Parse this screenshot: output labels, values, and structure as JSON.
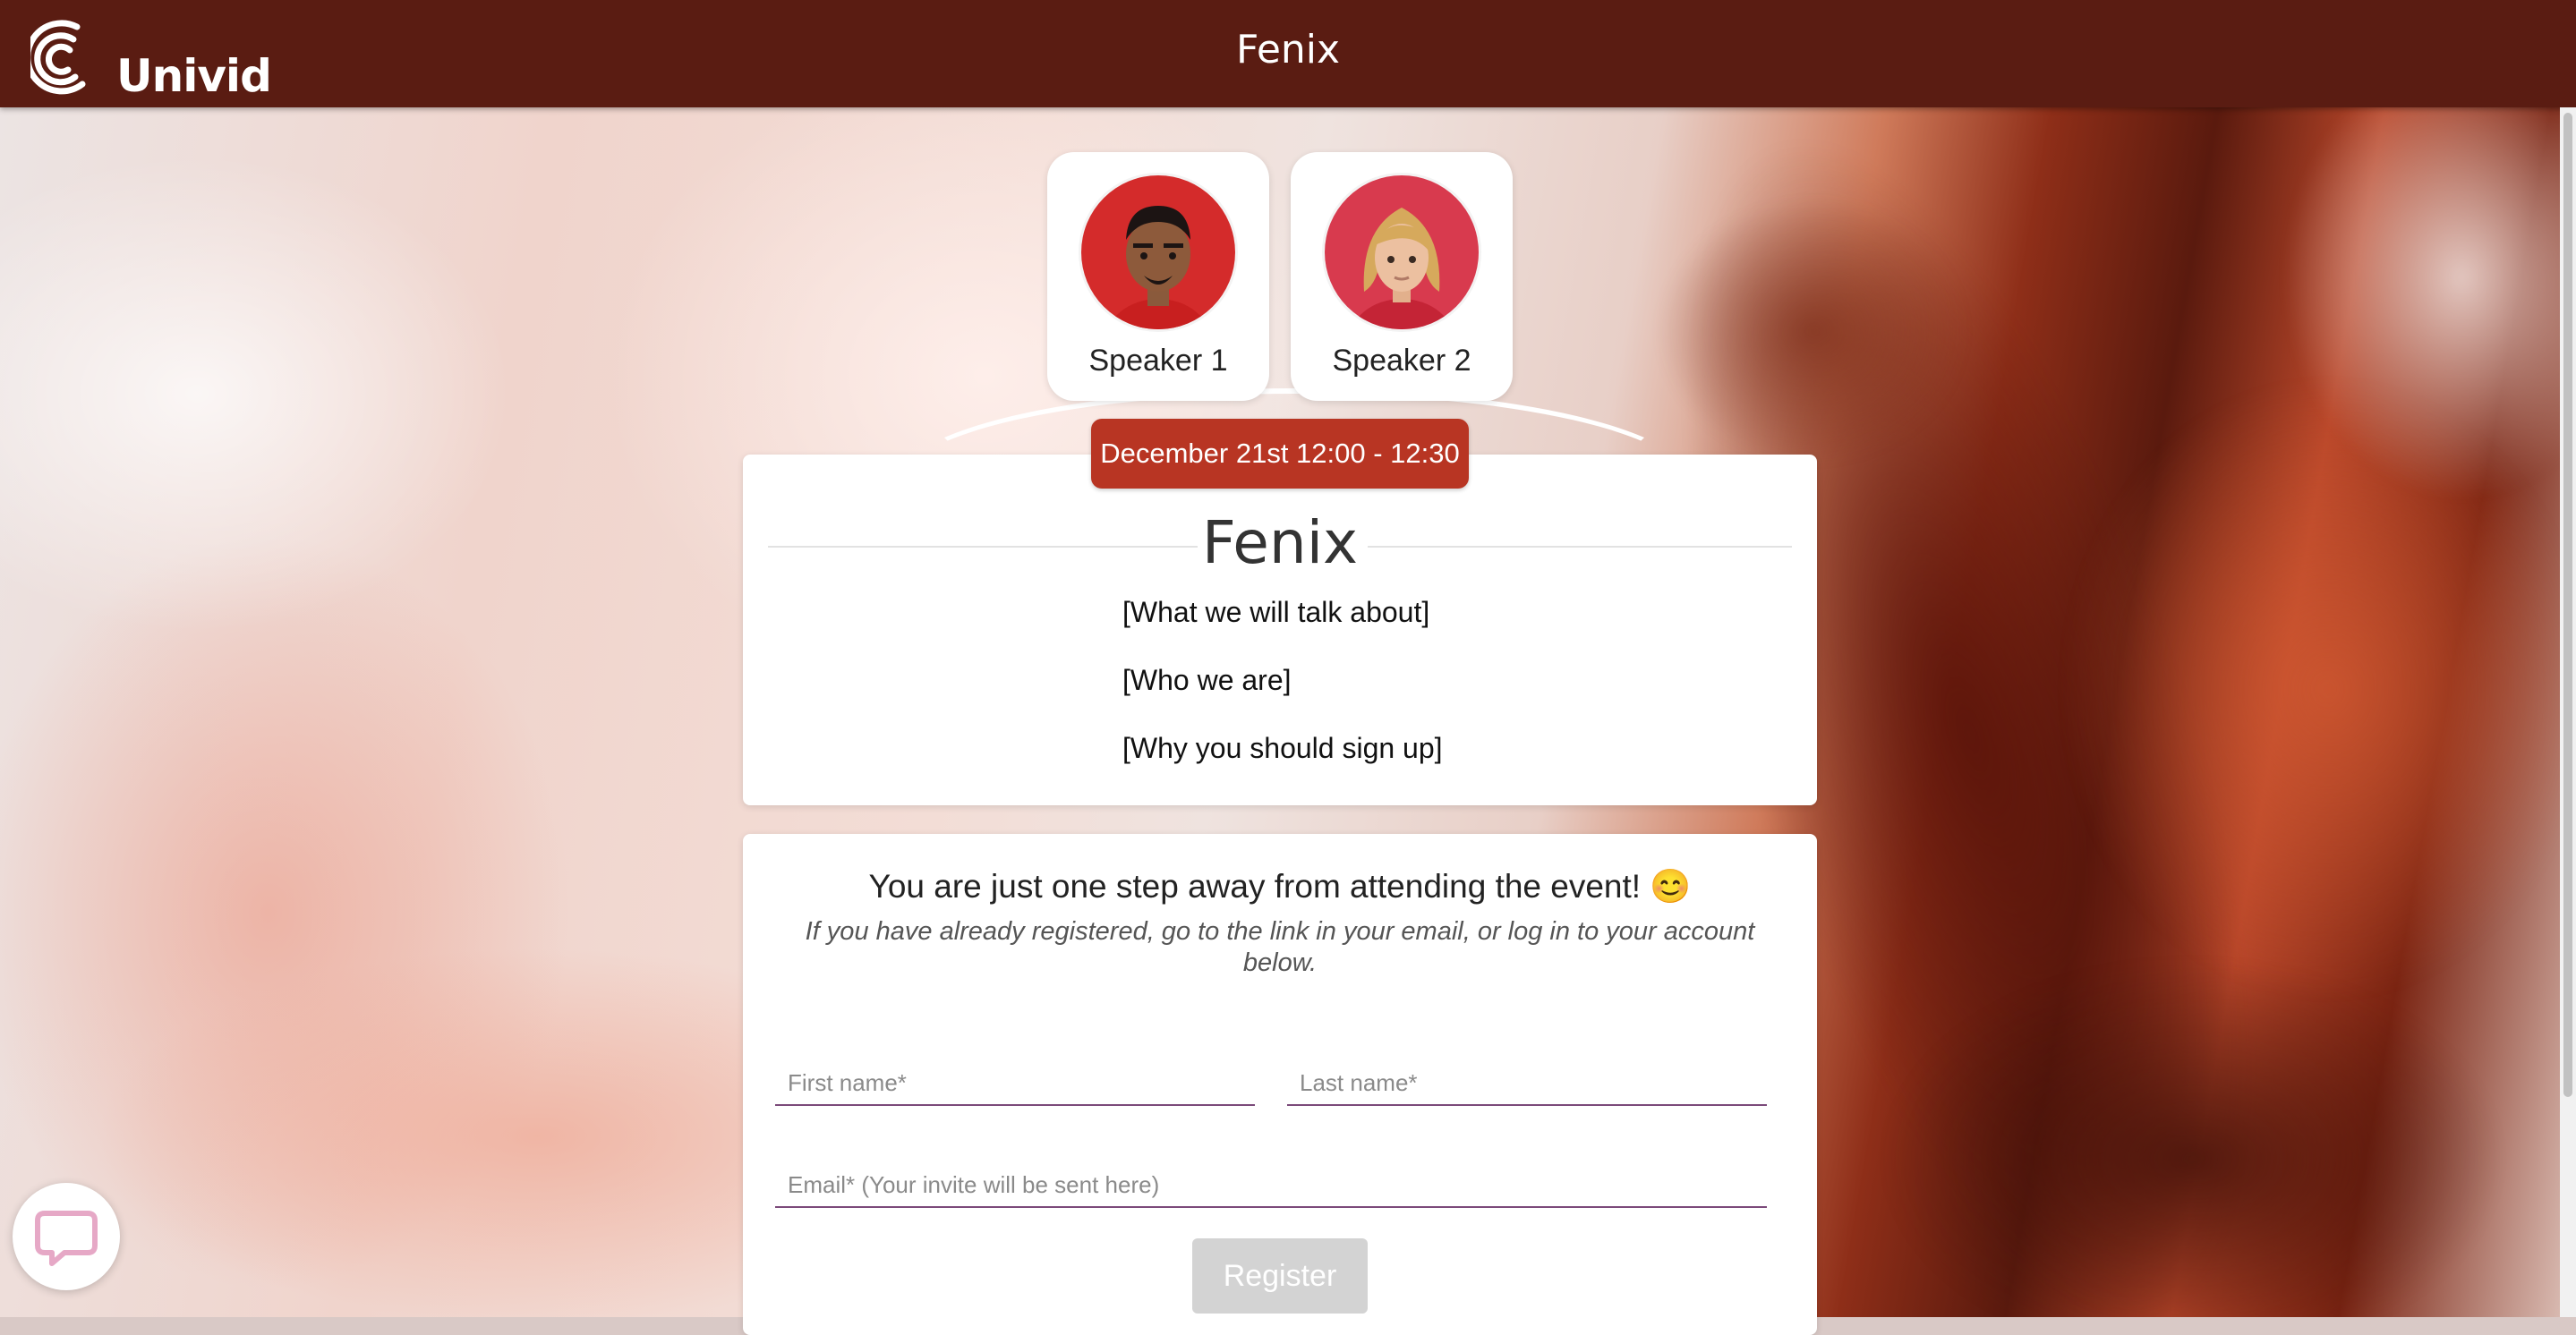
{
  "header": {
    "logo_text": "Univid",
    "title": "Fenix"
  },
  "speakers": [
    {
      "name": "Speaker 1"
    },
    {
      "name": "Speaker 2"
    }
  ],
  "event": {
    "date": "December 21st 12:00 - 12:30",
    "title": "Fenix",
    "bullets": [
      "[What we will talk about]",
      "[Who we are]",
      "[Why you should sign up]"
    ]
  },
  "registration": {
    "headline": "You are just one step away from attending the event! 😊",
    "subtext": "If you have already registered, go to the link in your email, or log in to your account below.",
    "first_name_placeholder": "First name*",
    "last_name_placeholder": "Last name*",
    "email_placeholder": "Email* (Your invite will be sent here)",
    "register_label": "Register"
  },
  "colors": {
    "header": "#5a1c12",
    "accent": "#b83523",
    "field_underline": "#7b4a7a"
  },
  "icons": {
    "logo": "univid-logo-icon",
    "chat": "chat-icon"
  }
}
